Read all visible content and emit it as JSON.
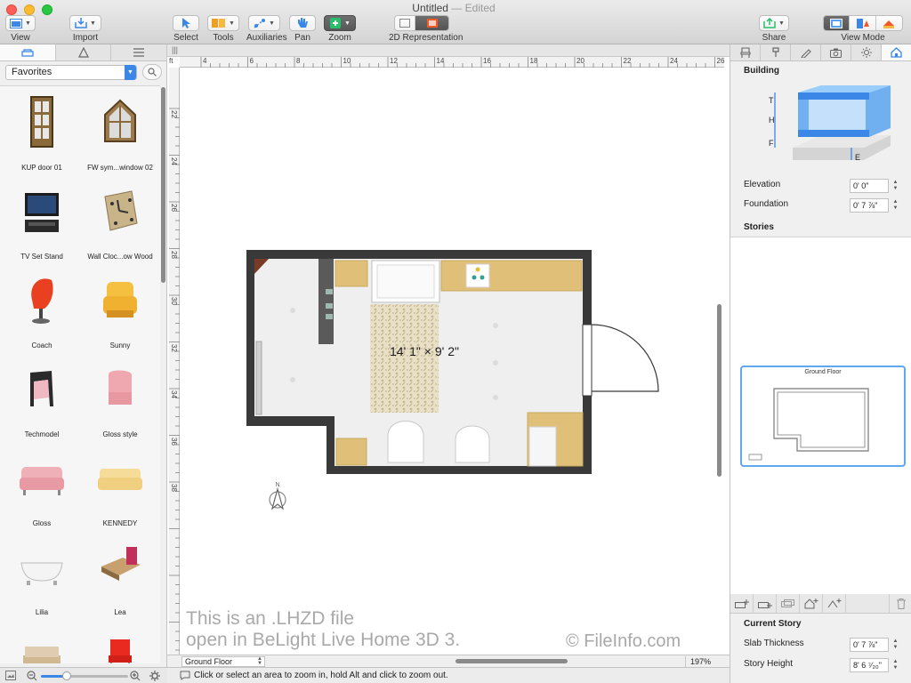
{
  "window": {
    "title": "Untitled",
    "title_suffix": "— Edited"
  },
  "toolbar": {
    "view": "View",
    "import": "Import",
    "select": "Select",
    "tools": "Tools",
    "auxiliaries": "Auxiliaries",
    "pan": "Pan",
    "zoom": "Zoom",
    "representation": "2D Representation",
    "share": "Share",
    "view_mode": "View Mode"
  },
  "library": {
    "dropdown": "Favorites",
    "items": [
      {
        "label": "KUP door 01",
        "icon": "door-icon"
      },
      {
        "label": "FW sym...window 02",
        "icon": "window-icon"
      },
      {
        "label": "TV Set Stand",
        "icon": "tv-stand-icon"
      },
      {
        "label": "Wall Cloc...ow Wood",
        "icon": "clock-icon"
      },
      {
        "label": "Coach",
        "icon": "red-chair-icon"
      },
      {
        "label": "Sunny",
        "icon": "armchair-icon"
      },
      {
        "label": "Techmodel",
        "icon": "chair-icon"
      },
      {
        "label": "Gloss style",
        "icon": "chair-icon"
      },
      {
        "label": "Gloss",
        "icon": "sofa-icon"
      },
      {
        "label": "KENNEDY",
        "icon": "sofa-icon"
      },
      {
        "label": "Lilia",
        "icon": "bathtub-icon"
      },
      {
        "label": "Lea",
        "icon": "bed-icon"
      }
    ]
  },
  "plan": {
    "dimension_label": "14' 1\" × 9' 2\"",
    "ruler_unit": "ft",
    "ruler_top": [
      "4",
      "6",
      "8",
      "10",
      "12",
      "14",
      "16",
      "18",
      "20",
      "22",
      "24",
      "26"
    ],
    "ruler_left": [
      "22",
      "24",
      "26",
      "28",
      "30",
      "32",
      "34",
      "36",
      "38"
    ],
    "watermark_line1": "This is an .LHZD file",
    "watermark_line2": "open in BeLight Live Home 3D 3.",
    "copyright": "© FileInfo.com",
    "level": "Ground Floor",
    "zoom": "197%"
  },
  "building": {
    "heading": "Building",
    "diagram_labels": [
      "T",
      "H",
      "F",
      "E"
    ],
    "elevation_label": "Elevation",
    "elevation_value": "0' 0\"",
    "foundation_label": "Foundation",
    "foundation_value": "0' 7 ⅞\"",
    "stories_heading": "Stories",
    "story_card_title": "Ground Floor"
  },
  "current_story": {
    "heading": "Current Story",
    "slab_label": "Slab Thickness",
    "slab_value": "0' 7 ⅞\"",
    "height_label": "Story Height",
    "height_value": "8' 6 ⁷⁄₂₀\""
  },
  "status": {
    "hint": "Click or select an area to zoom in, hold Alt and click to zoom out."
  },
  "colors": {
    "accent": "#3b87e8",
    "wall": "#3a3a3a",
    "cabinet": "#e0c078",
    "floor": "#eeeeee"
  }
}
